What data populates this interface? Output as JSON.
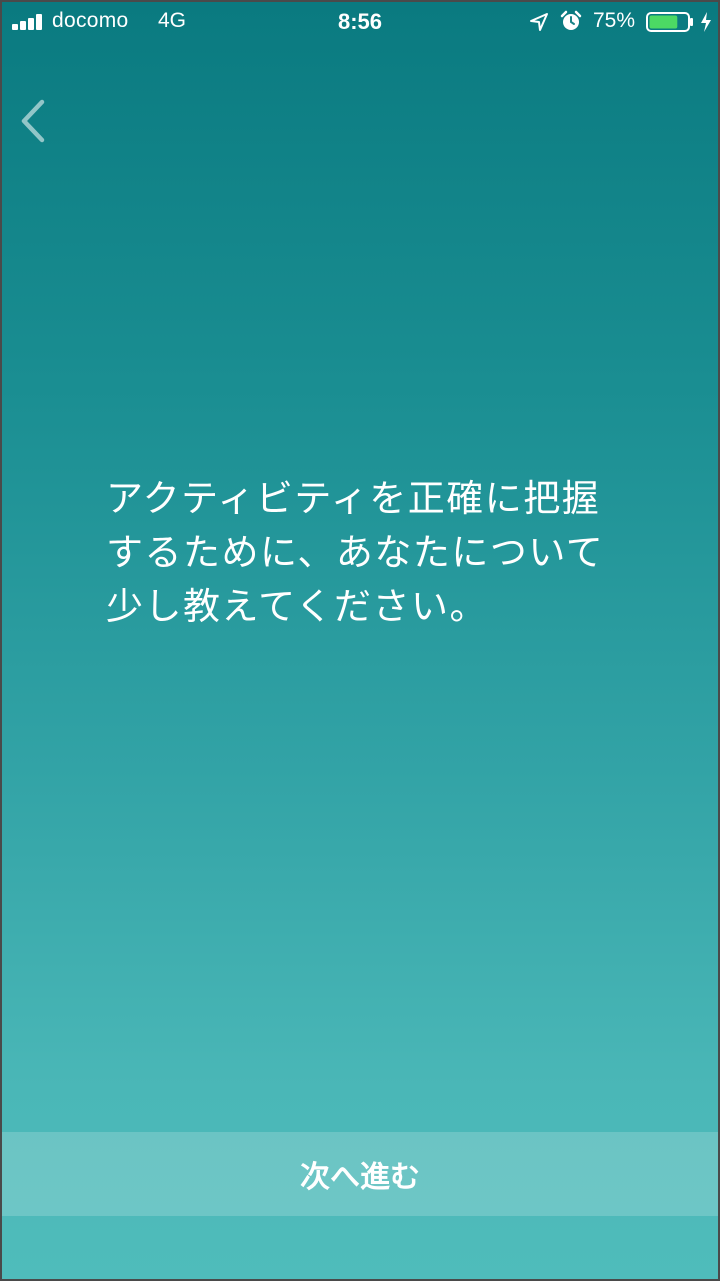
{
  "status_bar": {
    "carrier": "docomo",
    "network": "4G",
    "time": "8:56",
    "battery_percent_label": "75%",
    "battery_level": 0.75,
    "icons": [
      "signal-icon",
      "location-icon",
      "alarm-icon",
      "battery-icon",
      "charging-bolt-icon"
    ]
  },
  "navigation": {
    "back_icon": "chevron-left-icon"
  },
  "main": {
    "message": "アクティビティを正確に把握するために、あなたについて少し教えてください。"
  },
  "footer": {
    "next_label": "次へ進む"
  },
  "colors": {
    "gradient_top": "#0a7a80",
    "gradient_bottom": "#4fbcbb",
    "battery_fill": "#4cd964",
    "text": "#ffffff"
  }
}
